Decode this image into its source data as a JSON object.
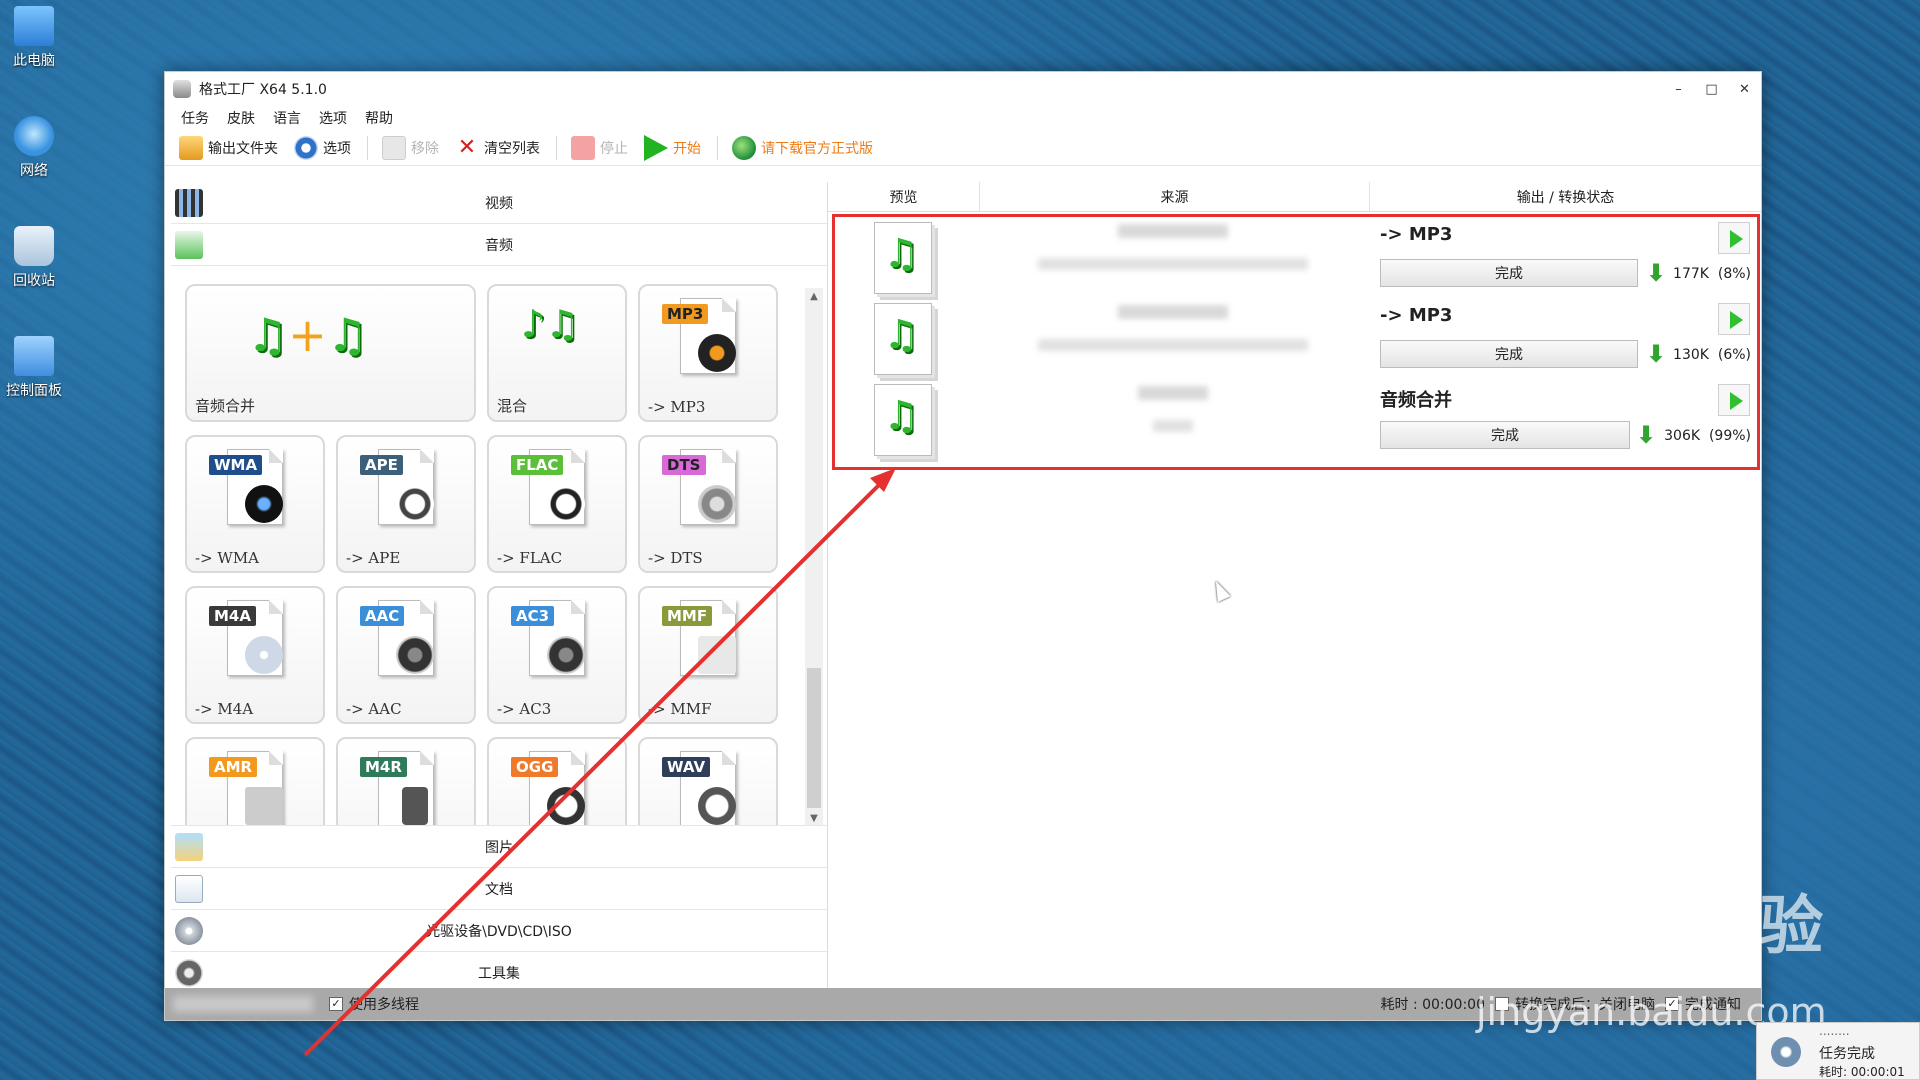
{
  "desktop": {
    "icons": [
      {
        "label": "此电脑",
        "icon": "computer-icon"
      },
      {
        "label": "网络",
        "icon": "network-icon"
      },
      {
        "label": "回收站",
        "icon": "recycle-bin-icon"
      },
      {
        "label": "控制面板",
        "icon": "control-panel-icon"
      }
    ]
  },
  "window": {
    "title": "格式工厂 X64 5.1.0",
    "controls": {
      "minimize": "–",
      "maximize": "□",
      "close": "✕"
    }
  },
  "menu": [
    "任务",
    "皮肤",
    "语言",
    "选项",
    "帮助"
  ],
  "toolbar": {
    "output_folder": "输出文件夹",
    "options": "选项",
    "remove": "移除",
    "clear_list": "清空列表",
    "stop": "停止",
    "start": "开始",
    "download_official": "请下载官方正式版"
  },
  "categories": {
    "video": "视频",
    "audio": "音频",
    "image": "图片",
    "document": "文档",
    "disc": "光驱设备\\DVD\\CD\\ISO",
    "tools": "工具集"
  },
  "audio_tiles": [
    {
      "label": "音频合并",
      "badge": ""
    },
    {
      "label": "混合",
      "badge": ""
    },
    {
      "label": "-> MP3",
      "badge": "MP3",
      "color": "#f29a1f"
    },
    {
      "label": "-> WMA",
      "badge": "WMA",
      "color": "#1f4e8c"
    },
    {
      "label": "-> APE",
      "badge": "APE",
      "color": "#3c5f7a"
    },
    {
      "label": "-> FLAC",
      "badge": "FLAC",
      "color": "#5cbf3a"
    },
    {
      "label": "-> DTS",
      "badge": "DTS",
      "color": "#d86ad8"
    },
    {
      "label": "-> M4A",
      "badge": "M4A",
      "color": "#3a3a3a"
    },
    {
      "label": "-> AAC",
      "badge": "AAC",
      "color": "#3a8fd8"
    },
    {
      "label": "-> AC3",
      "badge": "AC3",
      "color": "#3a8fd8"
    },
    {
      "label": "-> MMF",
      "badge": "MMF",
      "color": "#8a9a3a"
    },
    {
      "label": "",
      "badge": "AMR",
      "color": "#f29a1f"
    },
    {
      "label": "",
      "badge": "M4R",
      "color": "#2f7a5a"
    },
    {
      "label": "",
      "badge": "OGG",
      "color": "#f07a2a"
    },
    {
      "label": "",
      "badge": "WAV",
      "color": "#2f3f5a"
    }
  ],
  "task_list": {
    "headers": {
      "preview": "预览",
      "source": "来源",
      "output": "输出 / 转换状态"
    },
    "tasks": [
      {
        "output": "-> MP3",
        "status": "完成",
        "size": "177K",
        "percent": "(8%)"
      },
      {
        "output": "-> MP3",
        "status": "完成",
        "size": "130K",
        "percent": "(6%)"
      },
      {
        "output": "音频合并",
        "status": "完成",
        "size": "306K",
        "percent": "(99%)"
      }
    ]
  },
  "statusbar": {
    "multithread": "使用多线程",
    "elapsed": "耗时 : 00:00:00",
    "after_done": "转换完成后：关闭电脑",
    "notify": "完成通知"
  },
  "notification": {
    "dots": "........",
    "title": "任务完成",
    "time": "耗时: 00:00:01"
  },
  "watermark": {
    "logo": "Baidu经验",
    "url": "jingyan.baidu.com"
  },
  "colors": {
    "highlight": "#e53030",
    "accent_green": "#2fbf2f",
    "link_orange": "#ee7b16"
  }
}
